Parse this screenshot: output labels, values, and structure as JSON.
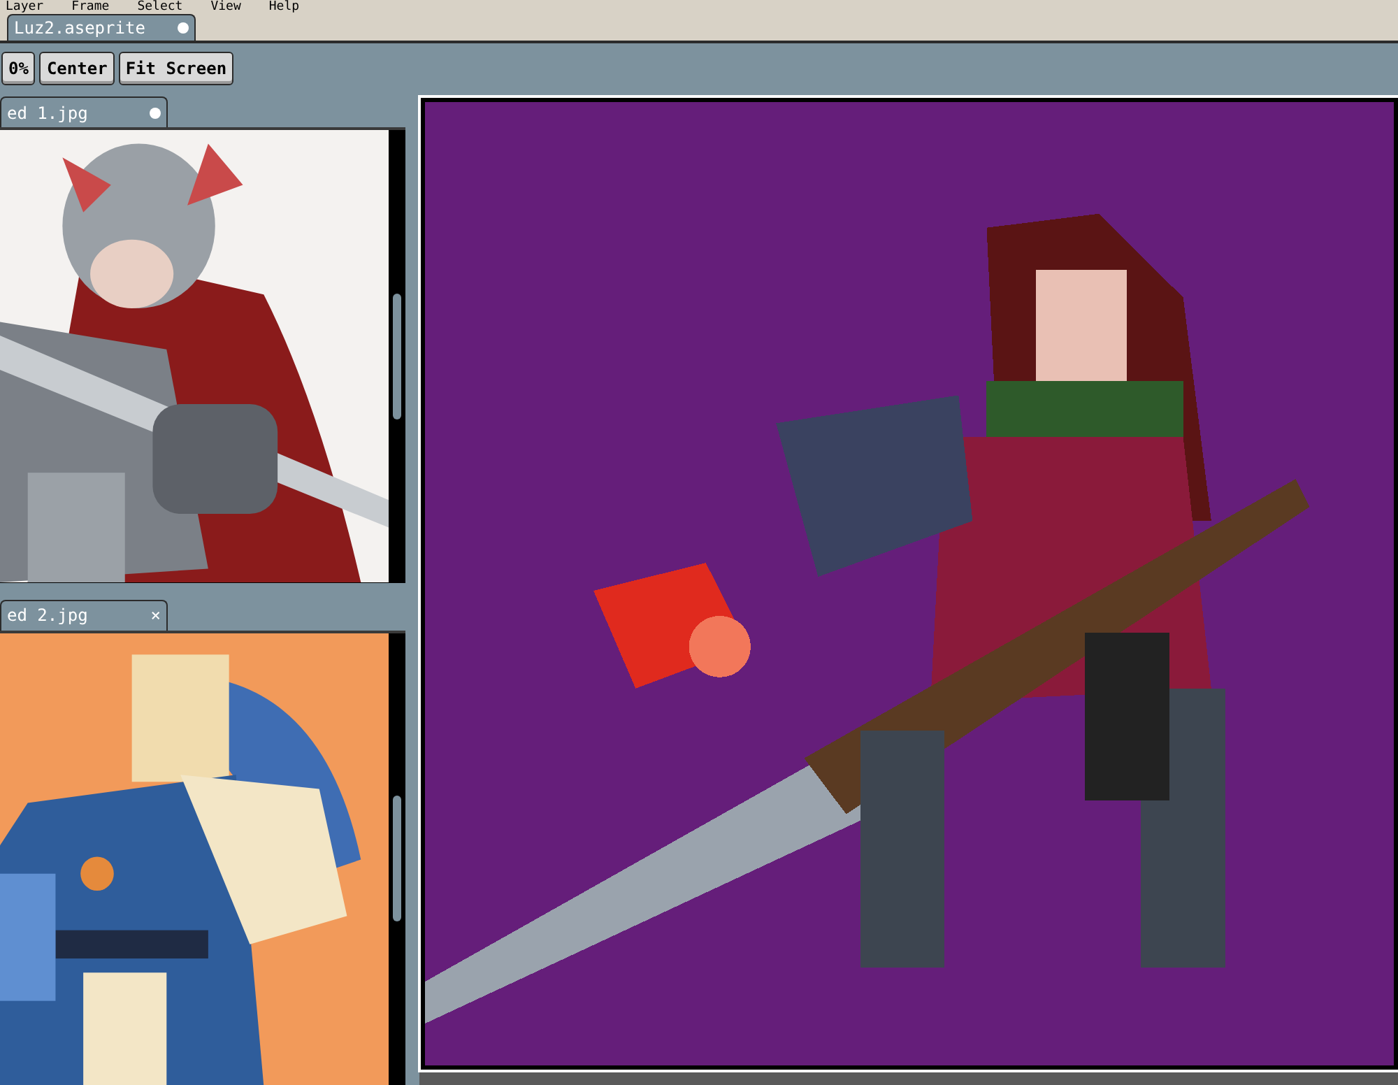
{
  "menu": [
    "Layer",
    "Frame",
    "Select",
    "View",
    "Help"
  ],
  "tabs": [
    {
      "label": "Luz2.aseprite",
      "modified": true,
      "selected": true
    }
  ],
  "toolbar": [
    "0%",
    "Center",
    "Fit Screen"
  ],
  "references": [
    {
      "title": "ed 1.jpg",
      "modified": true,
      "kind": "picture"
    },
    {
      "title": "ed 2.jpg",
      "modified": false,
      "close_label": "×",
      "kind": "picture"
    }
  ]
}
